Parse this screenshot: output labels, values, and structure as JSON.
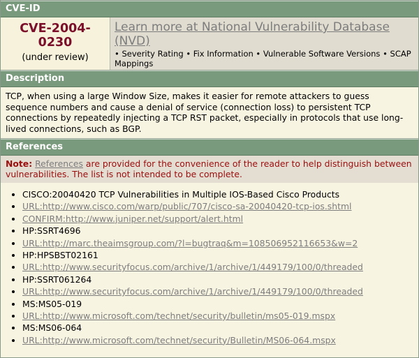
{
  "cve_id_header": "CVE-ID",
  "cve": {
    "id": "CVE-2004-0230",
    "status": "(under review)"
  },
  "nvd": {
    "link_text": "Learn more at National Vulnerability Database (NVD)",
    "subtext": "• Severity Rating • Fix Information • Vulnerable Software Versions • SCAP Mappings"
  },
  "description_header": "Description",
  "description": "TCP, when using a large Window Size, makes it easier for remote attackers to guess sequence numbers and cause a denial of service (connection loss) to persistent TCP connections by repeatedly injecting a TCP RST packet, especially in protocols that use long-lived connections, such as BGP.",
  "references_header": "References",
  "note": {
    "label": "Note:",
    "link": "References",
    "text": " are provided for the convenience of the reader to help distinguish between vulnerabilities. The list is not intended to be complete."
  },
  "references": [
    {
      "text": "CISCO:20040420 TCP Vulnerabilities in Multiple IOS-Based Cisco Products",
      "link": false
    },
    {
      "text": "URL:http://www.cisco.com/warp/public/707/cisco-sa-20040420-tcp-ios.shtml",
      "link": true
    },
    {
      "text": "CONFIRM:http://www.juniper.net/support/alert.html",
      "link": true
    },
    {
      "text": "HP:SSRT4696",
      "link": false
    },
    {
      "text": "URL:http://marc.theaimsgroup.com/?l=bugtraq&m=108506952116653&w=2",
      "link": true
    },
    {
      "text": "HP:HPSBST02161",
      "link": false
    },
    {
      "text": "URL:http://www.securityfocus.com/archive/1/archive/1/449179/100/0/threaded",
      "link": true
    },
    {
      "text": "HP:SSRT061264",
      "link": false
    },
    {
      "text": "URL:http://www.securityfocus.com/archive/1/archive/1/449179/100/0/threaded",
      "link": true
    },
    {
      "text": "MS:MS05-019",
      "link": false
    },
    {
      "text": "URL:http://www.microsoft.com/technet/security/bulletin/ms05-019.mspx",
      "link": true
    },
    {
      "text": "MS:MS06-064",
      "link": false
    },
    {
      "text": "URL:http://www.microsoft.com/technet/security/Bulletin/MS06-064.mspx",
      "link": true
    }
  ],
  "colors": {
    "header_bg": "#7a9a7d",
    "cve_id": "#7b0f2a",
    "note_text": "#9b0e0e",
    "link": "#7d7d7d"
  }
}
